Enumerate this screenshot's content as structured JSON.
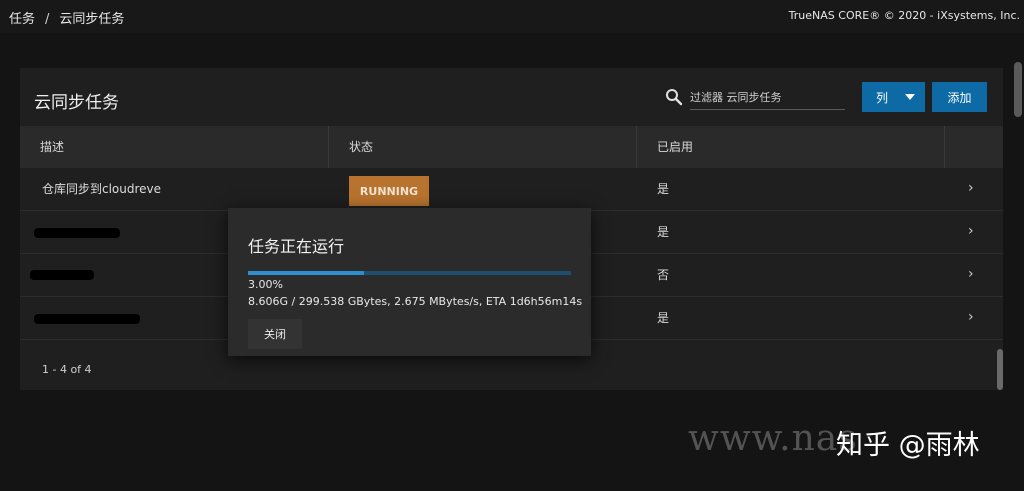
{
  "breadcrumb": {
    "parent": "任务",
    "separator": "/",
    "current": "云同步任务"
  },
  "copyright": "TrueNAS CORE® © 2020 - iXsystems, Inc.",
  "card": {
    "title": "云同步任务",
    "search_placeholder": "过滤器 云同步任务",
    "columns_button": "列",
    "add_button": "添加"
  },
  "table": {
    "headers": [
      "描述",
      "状态",
      "已启用"
    ],
    "rows": [
      {
        "description": "仓库同步到cloudreve",
        "status": "RUNNING",
        "enabled": "是"
      },
      {
        "description": "",
        "status": "",
        "enabled": "是"
      },
      {
        "description": "",
        "status": "",
        "enabled": "否"
      },
      {
        "description": "",
        "status": "",
        "enabled": "是"
      }
    ],
    "pagination": "1 - 4 of 4"
  },
  "dialog": {
    "title": "任务正在运行",
    "progress_value": 0.03,
    "percent": "3.00%",
    "detail": "8.606G / 299.538 GBytes, 2.675 MBytes/s, ETA 1d6h56m14s",
    "close_button": "关闭"
  },
  "watermark": {
    "url": "www.nas",
    "account": "知乎 @雨林"
  },
  "colors": {
    "primary": "#0d6aa4",
    "running_badge": "#b8732e",
    "background": "#141414"
  }
}
